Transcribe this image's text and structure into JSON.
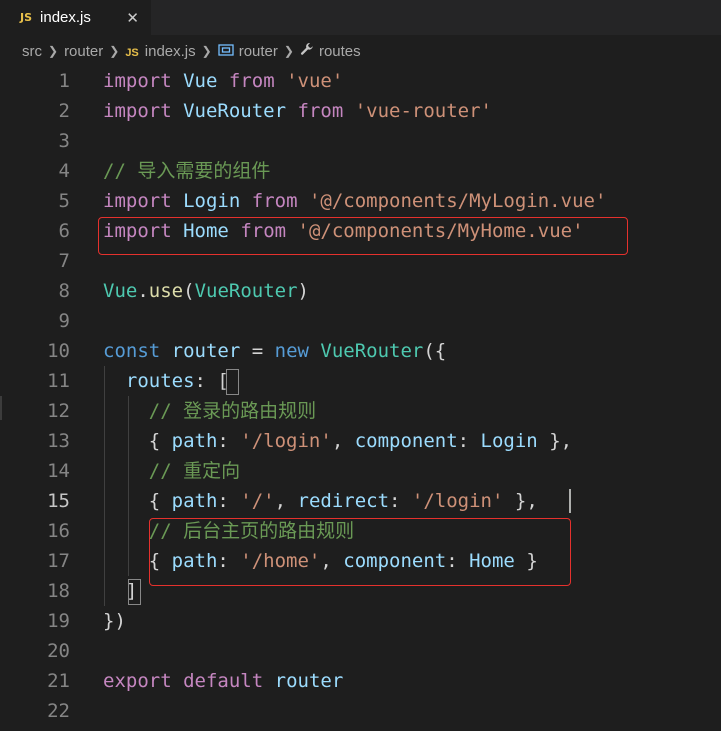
{
  "tab": {
    "badge": "JS",
    "label": "index.js",
    "close": "✕"
  },
  "breadcrumb": {
    "items": [
      "src",
      "router",
      "index.js",
      "router",
      "routes"
    ],
    "js_badge": "JS"
  },
  "lines": [
    {
      "n": "1",
      "tokens": [
        [
          "kw2",
          "import"
        ],
        [
          "pun",
          " "
        ],
        [
          "var",
          "Vue"
        ],
        [
          "pun",
          " "
        ],
        [
          "kw2",
          "from"
        ],
        [
          "pun",
          " "
        ],
        [
          "str",
          "'vue'"
        ]
      ]
    },
    {
      "n": "2",
      "tokens": [
        [
          "kw2",
          "import"
        ],
        [
          "pun",
          " "
        ],
        [
          "var",
          "VueRouter"
        ],
        [
          "pun",
          " "
        ],
        [
          "kw2",
          "from"
        ],
        [
          "pun",
          " "
        ],
        [
          "str",
          "'vue-router'"
        ]
      ]
    },
    {
      "n": "3",
      "tokens": []
    },
    {
      "n": "4",
      "tokens": [
        [
          "cm",
          "// 导入需要的组件"
        ]
      ]
    },
    {
      "n": "5",
      "tokens": [
        [
          "kw2",
          "import"
        ],
        [
          "pun",
          " "
        ],
        [
          "var",
          "Login"
        ],
        [
          "pun",
          " "
        ],
        [
          "kw2",
          "from"
        ],
        [
          "pun",
          " "
        ],
        [
          "str",
          "'@/components/MyLogin.vue'"
        ]
      ]
    },
    {
      "n": "6",
      "tokens": [
        [
          "kw2",
          "import"
        ],
        [
          "pun",
          " "
        ],
        [
          "var",
          "Home"
        ],
        [
          "pun",
          " "
        ],
        [
          "kw2",
          "from"
        ],
        [
          "pun",
          " "
        ],
        [
          "str",
          "'@/components/MyHome.vue'"
        ]
      ]
    },
    {
      "n": "7",
      "tokens": []
    },
    {
      "n": "8",
      "tokens": [
        [
          "cls",
          "Vue"
        ],
        [
          "pun",
          "."
        ],
        [
          "fn",
          "use"
        ],
        [
          "pun",
          "("
        ],
        [
          "cls",
          "VueRouter"
        ],
        [
          "pun",
          ")"
        ]
      ]
    },
    {
      "n": "9",
      "tokens": []
    },
    {
      "n": "10",
      "tokens": [
        [
          "kw",
          "const"
        ],
        [
          "pun",
          " "
        ],
        [
          "var",
          "router"
        ],
        [
          "pun",
          " = "
        ],
        [
          "kw",
          "new"
        ],
        [
          "pun",
          " "
        ],
        [
          "cls",
          "VueRouter"
        ],
        [
          "pun",
          "({"
        ]
      ]
    },
    {
      "n": "11",
      "tokens": [
        [
          "pun",
          "  "
        ],
        [
          "var",
          "routes"
        ],
        [
          "pun",
          ": ["
        ]
      ]
    },
    {
      "n": "12",
      "tokens": [
        [
          "pun",
          "    "
        ],
        [
          "cm",
          "// 登录的路由规则"
        ]
      ]
    },
    {
      "n": "13",
      "tokens": [
        [
          "pun",
          "    { "
        ],
        [
          "var",
          "path"
        ],
        [
          "pun",
          ": "
        ],
        [
          "str",
          "'/login'"
        ],
        [
          "pun",
          ", "
        ],
        [
          "var",
          "component"
        ],
        [
          "pun",
          ": "
        ],
        [
          "var",
          "Login"
        ],
        [
          "pun",
          " },"
        ]
      ]
    },
    {
      "n": "14",
      "tokens": [
        [
          "pun",
          "    "
        ],
        [
          "cm",
          "// 重定向"
        ]
      ]
    },
    {
      "n": "15",
      "tokens": [
        [
          "pun",
          "    { "
        ],
        [
          "var",
          "path"
        ],
        [
          "pun",
          ": "
        ],
        [
          "str",
          "'/'"
        ],
        [
          "pun",
          ", "
        ],
        [
          "var",
          "redirect"
        ],
        [
          "pun",
          ": "
        ],
        [
          "str",
          "'/login'"
        ],
        [
          "pun",
          " },"
        ]
      ]
    },
    {
      "n": "16",
      "tokens": [
        [
          "pun",
          "    "
        ],
        [
          "cm",
          "// 后台主页的路由规则"
        ]
      ]
    },
    {
      "n": "17",
      "tokens": [
        [
          "pun",
          "    { "
        ],
        [
          "var",
          "path"
        ],
        [
          "pun",
          ": "
        ],
        [
          "str",
          "'/home'"
        ],
        [
          "pun",
          ", "
        ],
        [
          "var",
          "component"
        ],
        [
          "pun",
          ": "
        ],
        [
          "var",
          "Home"
        ],
        [
          "pun",
          " }"
        ]
      ]
    },
    {
      "n": "18",
      "tokens": [
        [
          "pun",
          "  ]"
        ]
      ]
    },
    {
      "n": "19",
      "tokens": [
        [
          "pun",
          "})"
        ]
      ]
    },
    {
      "n": "20",
      "tokens": []
    },
    {
      "n": "21",
      "tokens": [
        [
          "kw2",
          "export"
        ],
        [
          "pun",
          " "
        ],
        [
          "kw2",
          "default"
        ],
        [
          "pun",
          " "
        ],
        [
          "var",
          "router"
        ]
      ]
    },
    {
      "n": "22",
      "tokens": []
    }
  ],
  "active_line": "15"
}
